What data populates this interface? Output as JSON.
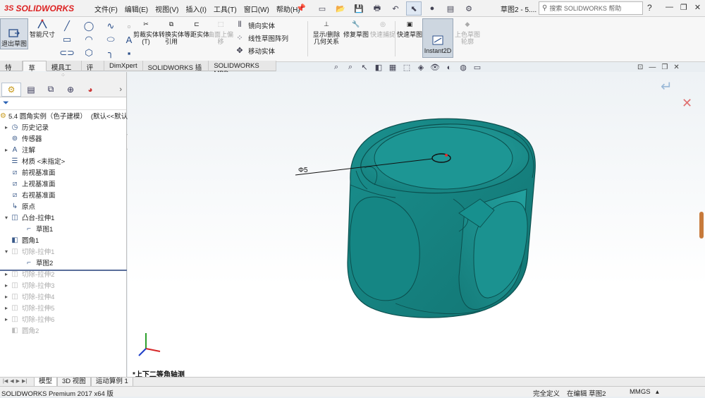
{
  "app": {
    "logo": "SOLIDWORKS",
    "logo_mark": "3S"
  },
  "menu": [
    "文件(F)",
    "编辑(E)",
    "视图(V)",
    "插入(I)",
    "工具(T)",
    "窗口(W)",
    "帮助(H)"
  ],
  "document_title": "草图2 - 5....",
  "search_placeholder": "搜索 SOLIDWORKS 帮助",
  "ribbon": {
    "exit_sketch": "退出草图",
    "smart_dim": "智能尺寸",
    "trim": "剪裁实体(T)",
    "convert": "转换实体引用",
    "offset": "等距实体",
    "surface_offset": "曲面上偏移",
    "mirror": "镜向实体",
    "linear_pattern": "线性草图阵列",
    "move": "移动实体",
    "display_delete": "显示/删除几何关系",
    "repair": "修复草图",
    "quick_snap": "快速捕捉",
    "rapid_sketch": "快速草图",
    "instant2d": "Instant2D",
    "shaded_sketch": "上色草图轮廓"
  },
  "command_tabs": [
    "特征",
    "草图",
    "模具工具",
    "评估",
    "DimXpert",
    "SOLIDWORKS 插件",
    "SOLIDWORKS MBD"
  ],
  "command_tabs_active": 1,
  "tree": {
    "root": "5.4 圆角实例（色子建模）",
    "root_config": "(默认<<默认",
    "items": [
      {
        "label": "历史记录",
        "indent": 1,
        "toggle": "▸",
        "icon": "history-icon",
        "grey": false
      },
      {
        "label": "传感器",
        "indent": 1,
        "toggle": "",
        "icon": "sensor-icon",
        "grey": false
      },
      {
        "label": "注解",
        "indent": 1,
        "toggle": "▸",
        "icon": "annotation-icon",
        "grey": false
      },
      {
        "label": "材质 <未指定>",
        "indent": 1,
        "toggle": "",
        "icon": "material-icon",
        "grey": false
      },
      {
        "label": "前视基准面",
        "indent": 1,
        "toggle": "",
        "icon": "plane-icon",
        "grey": false
      },
      {
        "label": "上视基准面",
        "indent": 1,
        "toggle": "",
        "icon": "plane-icon",
        "grey": false
      },
      {
        "label": "右视基准面",
        "indent": 1,
        "toggle": "",
        "icon": "plane-icon",
        "grey": false
      },
      {
        "label": "原点",
        "indent": 1,
        "toggle": "",
        "icon": "origin-icon",
        "grey": false
      },
      {
        "label": "凸台-拉伸1",
        "indent": 1,
        "toggle": "▾",
        "icon": "extrude-icon",
        "grey": false
      },
      {
        "label": "草图1",
        "indent": 2,
        "toggle": "",
        "icon": "sketch-icon",
        "grey": false
      },
      {
        "label": "圆角1",
        "indent": 1,
        "toggle": "",
        "icon": "fillet-icon",
        "grey": false
      },
      {
        "label": "切除-拉伸1",
        "indent": 1,
        "toggle": "▾",
        "icon": "cut-extrude-icon",
        "grey": true
      },
      {
        "label": "草图2",
        "indent": 2,
        "toggle": "",
        "icon": "sketch-icon",
        "grey": false
      },
      {
        "label": "切除-拉伸2",
        "indent": 1,
        "toggle": "▸",
        "icon": "cut-extrude-icon",
        "grey": true
      },
      {
        "label": "切除-拉伸3",
        "indent": 1,
        "toggle": "▸",
        "icon": "cut-extrude-icon",
        "grey": true
      },
      {
        "label": "切除-拉伸4",
        "indent": 1,
        "toggle": "▸",
        "icon": "cut-extrude-icon",
        "grey": true
      },
      {
        "label": "切除-拉伸5",
        "indent": 1,
        "toggle": "▸",
        "icon": "cut-extrude-icon",
        "grey": true
      },
      {
        "label": "切除-拉伸6",
        "indent": 1,
        "toggle": "▸",
        "icon": "cut-extrude-icon",
        "grey": true
      },
      {
        "label": "圆角2",
        "indent": 1,
        "toggle": "",
        "icon": "fillet-icon",
        "grey": true
      }
    ]
  },
  "viewport": {
    "dimension_label": "Φ5",
    "view_orientation": "*上下二等角轴测",
    "model_color": "#1f9a98"
  },
  "bottom_tabs": [
    "模型",
    "3D 视图",
    "运动算例 1"
  ],
  "bottom_tabs_active": 0,
  "status": {
    "product": "SOLIDWORKS Premium 2017 x64 版",
    "definition": "完全定义",
    "editing": "在编辑 草图2",
    "units": "MMGS"
  }
}
